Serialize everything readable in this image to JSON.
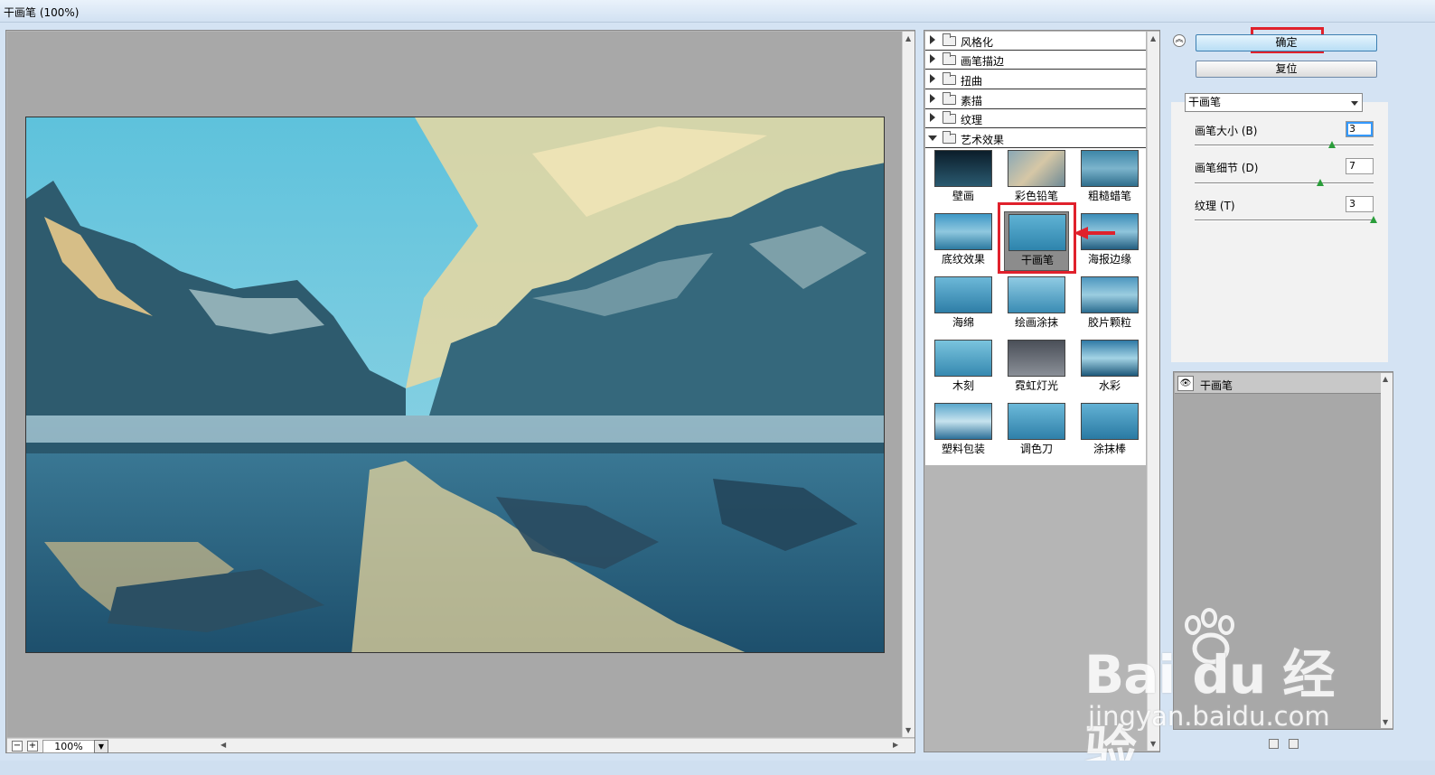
{
  "window": {
    "title": "干画笔 (100%)"
  },
  "preview": {
    "zoom": "100%"
  },
  "gallery": {
    "categories": [
      {
        "label": "风格化"
      },
      {
        "label": "画笔描边"
      },
      {
        "label": "扭曲"
      },
      {
        "label": "素描"
      },
      {
        "label": "纹理"
      },
      {
        "label": "艺术效果"
      }
    ],
    "thumbnails": [
      {
        "label": "壁画"
      },
      {
        "label": "彩色铅笔"
      },
      {
        "label": "粗糙蜡笔"
      },
      {
        "label": "底纹效果"
      },
      {
        "label": "干画笔"
      },
      {
        "label": "海报边缘"
      },
      {
        "label": "海绵"
      },
      {
        "label": "绘画涂抹"
      },
      {
        "label": "胶片颗粒"
      },
      {
        "label": "木刻"
      },
      {
        "label": "霓虹灯光"
      },
      {
        "label": "水彩"
      },
      {
        "label": "塑料包装"
      },
      {
        "label": "调色刀"
      },
      {
        "label": "涂抹棒"
      }
    ],
    "selected": "干画笔"
  },
  "buttons": {
    "ok": "确定",
    "reset": "复位"
  },
  "settings": {
    "filter_select": "干画笔",
    "params": [
      {
        "label": "画笔大小 (B)",
        "value": "3",
        "level_fraction": 0.77
      },
      {
        "label": "画笔细节 (D)",
        "value": "7",
        "level_fraction": 0.7
      },
      {
        "label": "纹理 (T)",
        "value": "3",
        "level_fraction": 1.0
      }
    ]
  },
  "layers": {
    "items": [
      {
        "name": "干画笔"
      }
    ]
  },
  "watermark": {
    "logo_text": "Bai du 经验",
    "url": "jingyan.baidu.com"
  },
  "colors": {
    "highlight_red": "#e0212c",
    "slider_green": "#2a9d3a",
    "ok_button": "#b8def5"
  }
}
